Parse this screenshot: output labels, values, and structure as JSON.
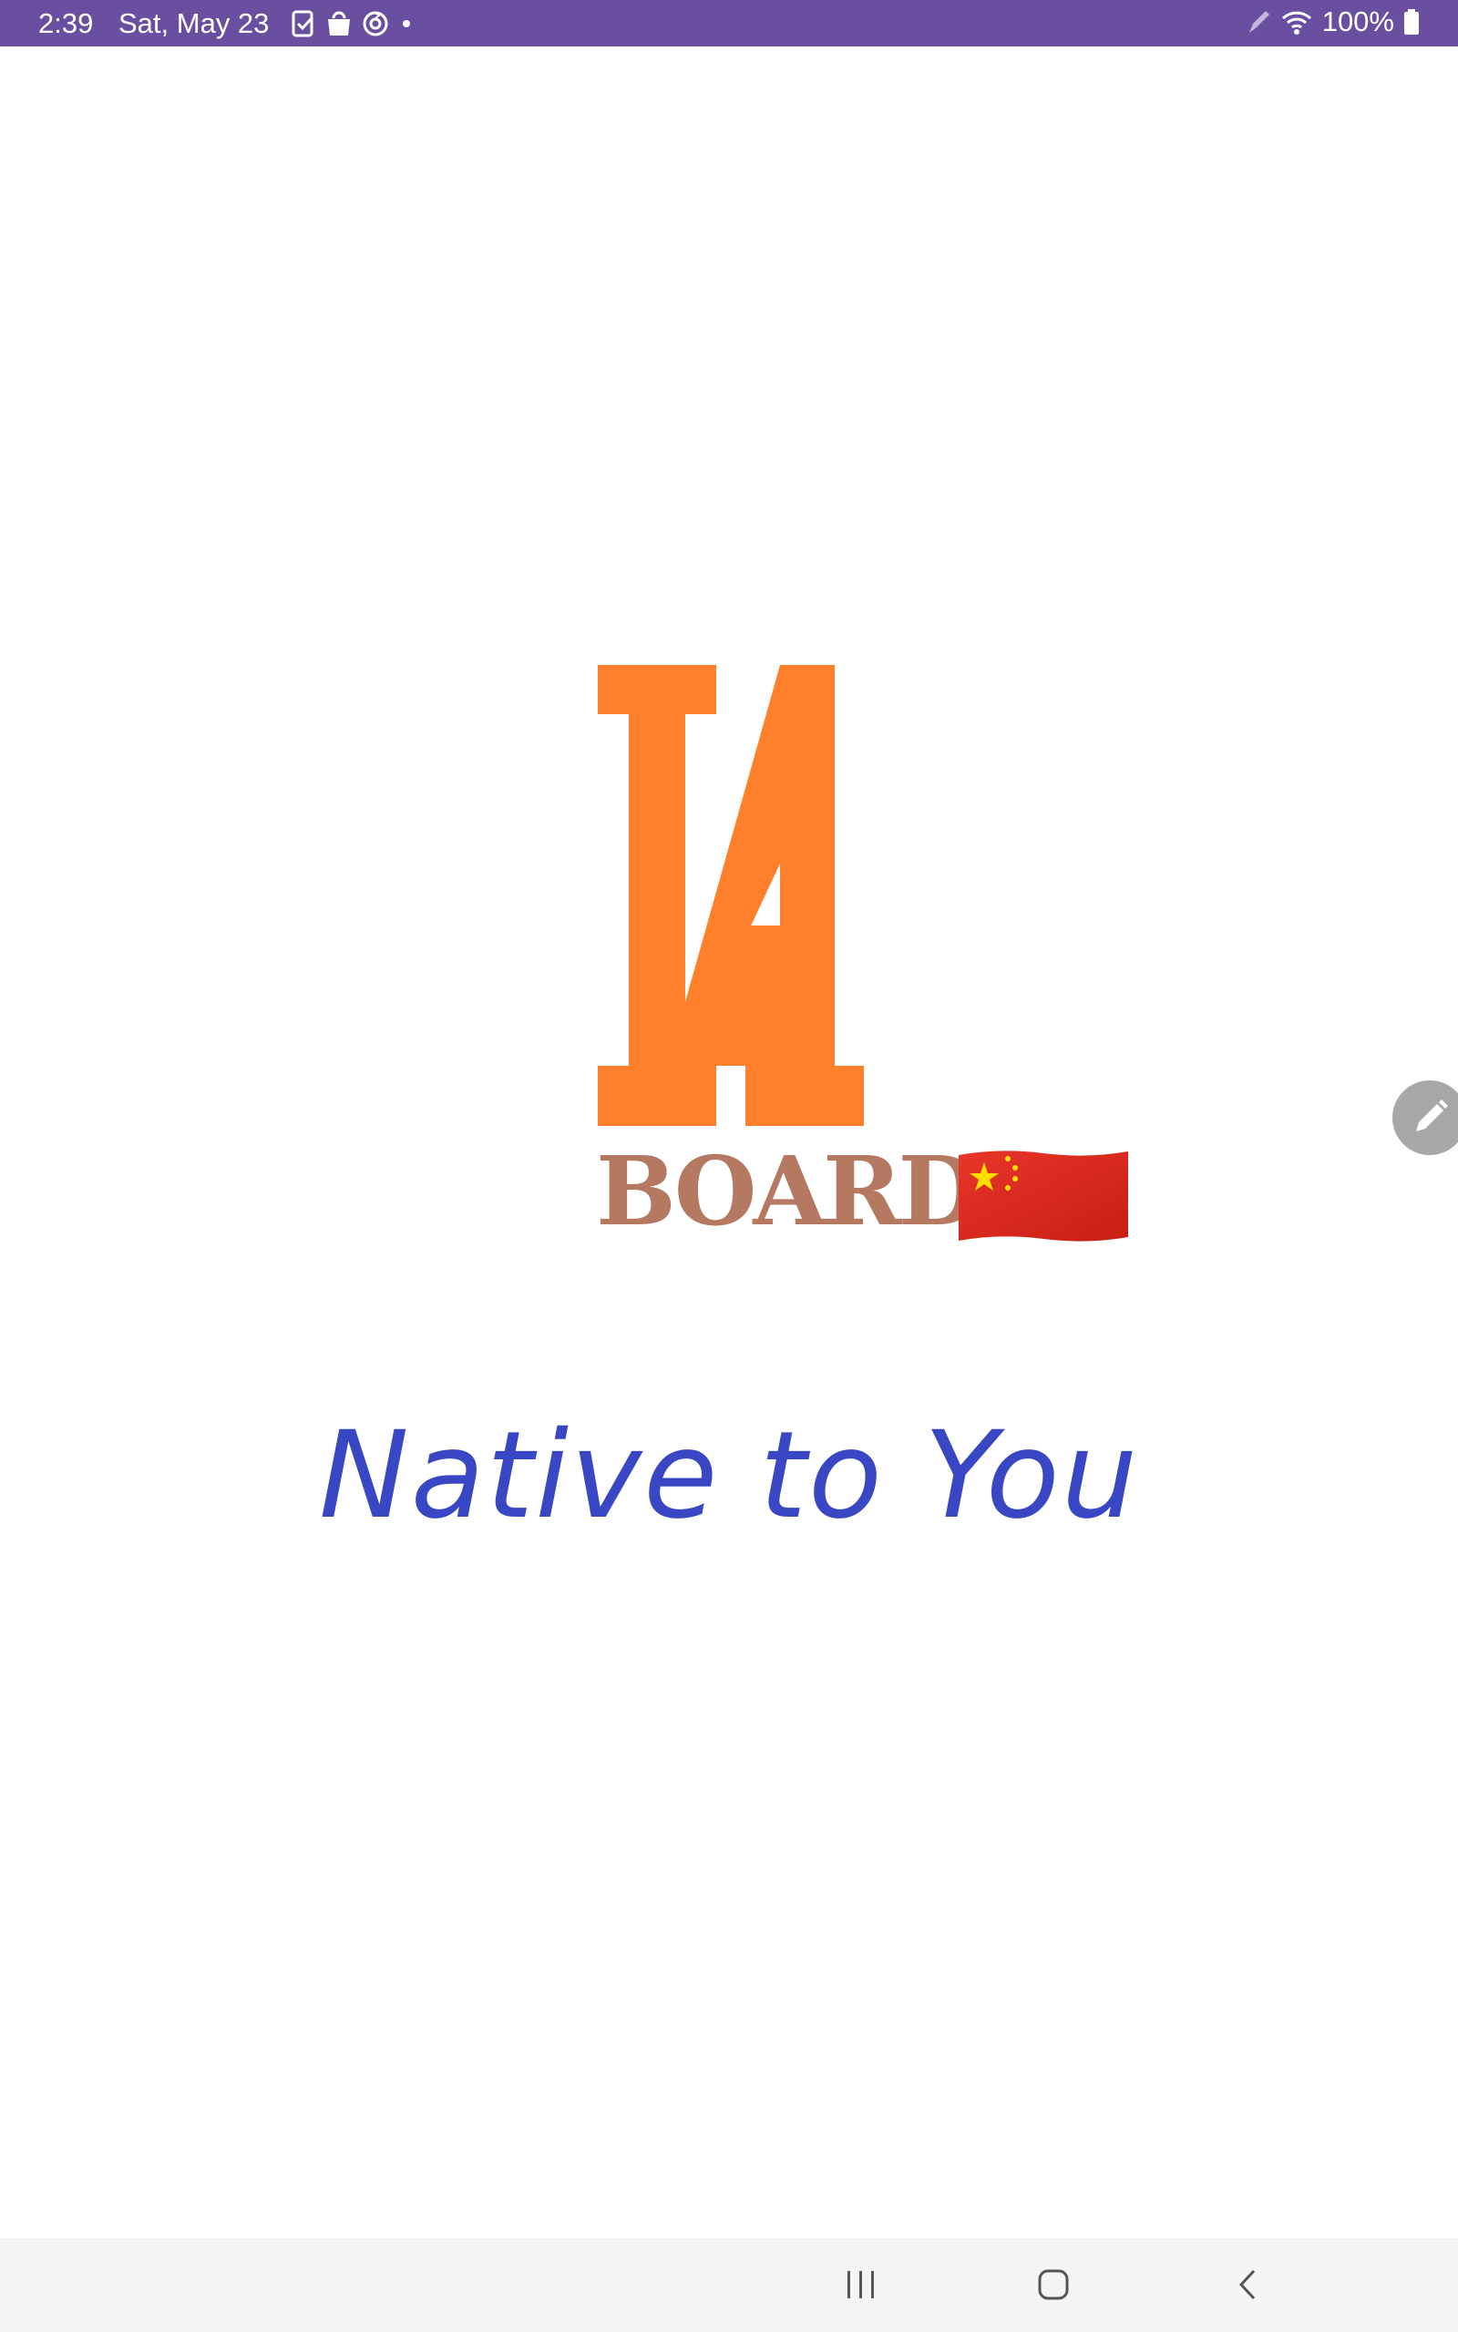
{
  "colors": {
    "status_bar_bg": "#6a4fa1",
    "logo_orange": "#ff7f2a",
    "board_brown": "#b57962",
    "tagline_blue": "#3a47c4",
    "nav_bar_bg": "#f4f4f4"
  },
  "status_bar": {
    "time": "2:39",
    "date": "Sat, May 23",
    "battery": "100%",
    "left_icons": [
      "task-check-icon",
      "shopping-bag-icon",
      "sync-icon",
      "dot-icon"
    ],
    "right_icons": [
      "pen-icon",
      "wifi-icon",
      "battery-icon"
    ]
  },
  "splash": {
    "logo_letter_icon": "n-logo-icon",
    "brand_word": "BOARD",
    "flag_icon": "china-flag-icon",
    "tagline": "Native to You"
  },
  "floating": {
    "edit_icon": "pencil-icon"
  },
  "nav_bar": {
    "buttons": [
      "recents-icon",
      "home-icon",
      "back-icon"
    ]
  }
}
